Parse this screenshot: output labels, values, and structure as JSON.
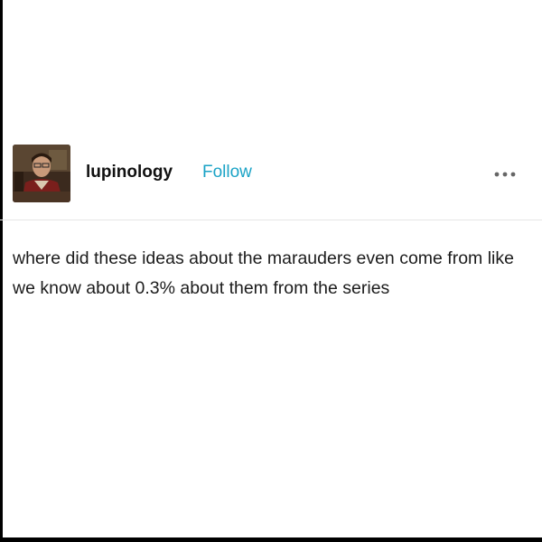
{
  "post": {
    "author": {
      "username": "lupinology",
      "avatar_icon": "user-avatar-photo"
    },
    "follow_label": "Follow",
    "more_icon": "more-options-icon",
    "body_text": "where did these ideas about the marauders even come from like we know about 0.3% about them from the series"
  },
  "colors": {
    "follow": "#1ba3c6",
    "text": "#1c1c1c",
    "background": "#ffffff",
    "divider": "#e6e6e6"
  }
}
